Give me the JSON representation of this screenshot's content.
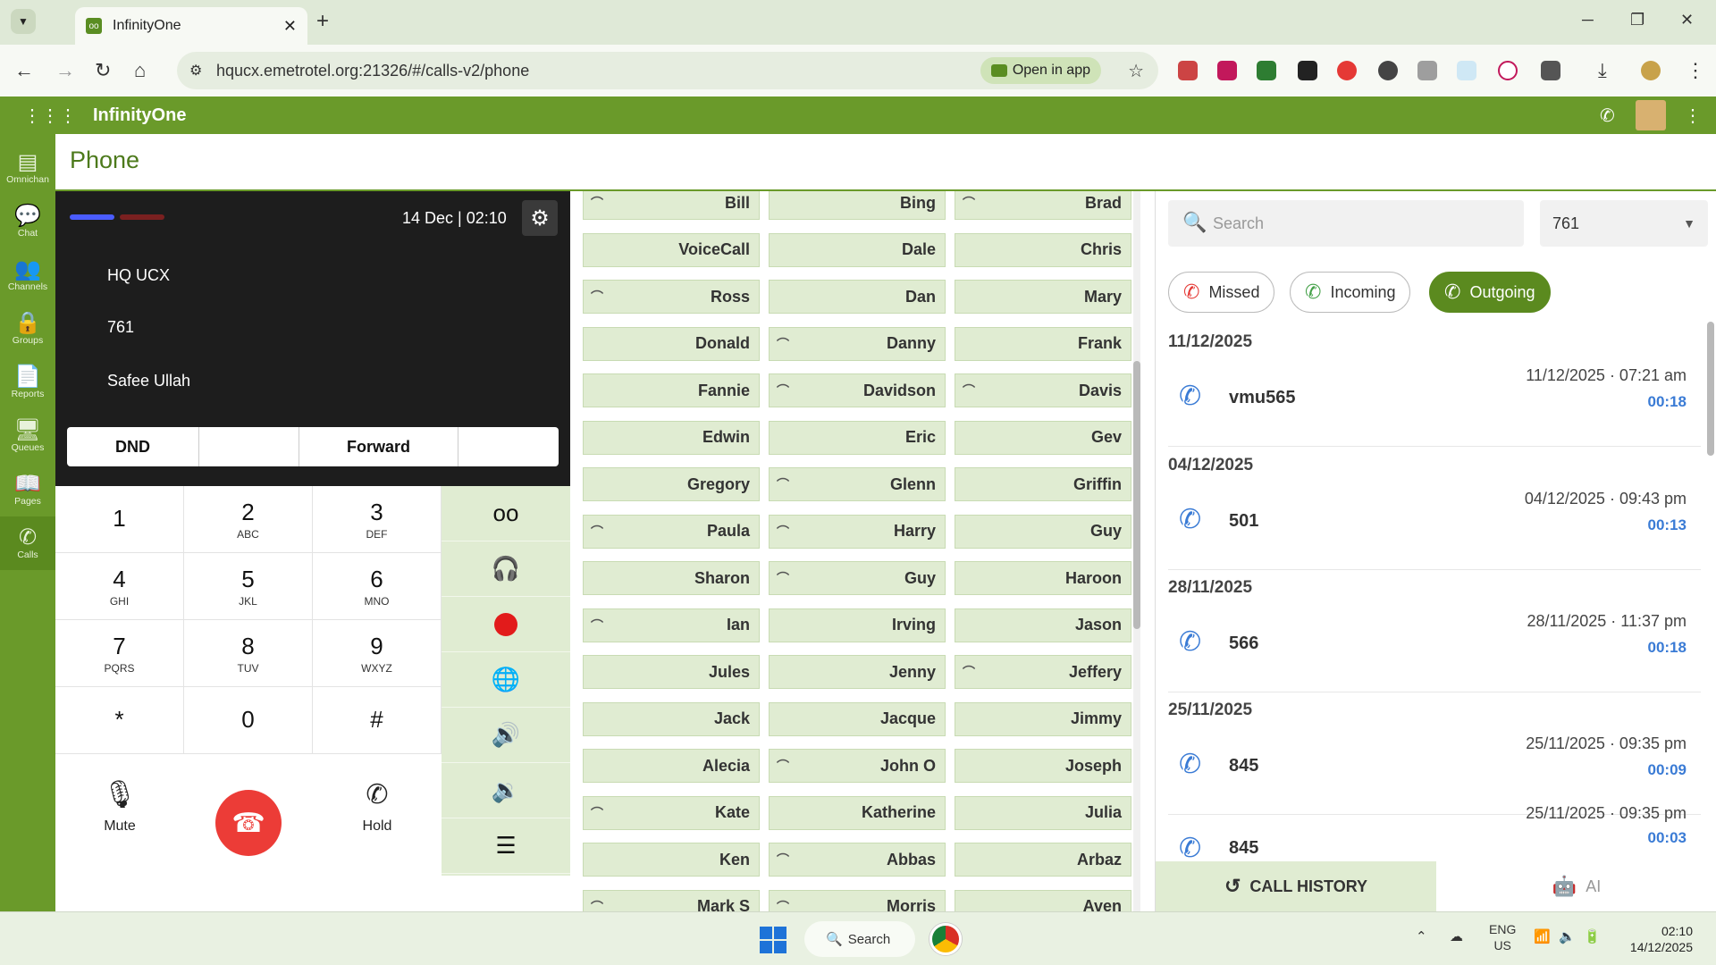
{
  "browser": {
    "tab_title": "InfinityOne",
    "url": "hqucx.emetrotel.org:21326/#/calls-v2/phone",
    "open_in_app": "Open in app"
  },
  "app": {
    "title": "InfinityOne"
  },
  "sidebar": {
    "items": [
      {
        "label": "Omnichan",
        "icon": "omnichannel-icon"
      },
      {
        "label": "Chat",
        "icon": "chat-icon"
      },
      {
        "label": "Channels",
        "icon": "channels-icon"
      },
      {
        "label": "Groups",
        "icon": "groups-icon"
      },
      {
        "label": "Reports",
        "icon": "reports-icon"
      },
      {
        "label": "Queues",
        "icon": "queues-icon"
      },
      {
        "label": "Pages",
        "icon": "pages-icon"
      },
      {
        "label": "Calls",
        "icon": "calls-icon"
      }
    ]
  },
  "page": {
    "title": "Phone"
  },
  "phone": {
    "date": "14 Dec",
    "time": "02:10",
    "server": "HQ UCX",
    "extension": "761",
    "user": "Safee Ullah",
    "controls": [
      "DND",
      "",
      "Forward",
      ""
    ],
    "keys": [
      {
        "d": "1",
        "l": ""
      },
      {
        "d": "2",
        "l": "ABC"
      },
      {
        "d": "3",
        "l": "DEF"
      },
      {
        "d": "4",
        "l": "GHI"
      },
      {
        "d": "5",
        "l": "JKL"
      },
      {
        "d": "6",
        "l": "MNO"
      },
      {
        "d": "7",
        "l": "PQRS"
      },
      {
        "d": "8",
        "l": "TUV"
      },
      {
        "d": "9",
        "l": "WXYZ"
      },
      {
        "d": "*",
        "l": ""
      },
      {
        "d": "0",
        "l": ""
      },
      {
        "d": "#",
        "l": ""
      }
    ],
    "mute_label": "Mute",
    "hold_label": "Hold"
  },
  "blf": [
    [
      "Bill",
      "Bing",
      "Brad"
    ],
    [
      "VoiceCall",
      "Dale",
      "Chris"
    ],
    [
      "Ross",
      "Dan",
      "Mary"
    ],
    [
      "Donald",
      "Danny",
      "Frank"
    ],
    [
      "Fannie",
      "Davidson",
      "Davis"
    ],
    [
      "Edwin",
      "Eric",
      "Gev"
    ],
    [
      "Gregory",
      "Glenn",
      "Griffin"
    ],
    [
      "Paula",
      "Harry",
      "Guy"
    ],
    [
      "Sharon",
      "Guy",
      "Haroon"
    ],
    [
      "Ian",
      "Irving",
      "Jason"
    ],
    [
      "Jules",
      "Jenny",
      "Jeffery"
    ],
    [
      "Jack",
      "Jacque",
      "Jimmy"
    ],
    [
      "Alecia",
      "John O",
      "Joseph"
    ],
    [
      "Kate",
      "Katherine",
      "Julia"
    ],
    [
      "Ken",
      "Abbas",
      "Arbaz"
    ],
    [
      "Mark S",
      "Morris",
      "Aven"
    ]
  ],
  "history": {
    "search_placeholder": "Search",
    "selected_ext": "761",
    "filters": {
      "missed": "Missed",
      "incoming": "Incoming",
      "outgoing": "Outgoing"
    },
    "groups": [
      {
        "date": "11/12/2025",
        "calls": [
          {
            "name": "vmu565",
            "ts": "11/12/2025 · 07:21 am",
            "dur": "00:18"
          }
        ]
      },
      {
        "date": "04/12/2025",
        "calls": [
          {
            "name": "501",
            "ts": "04/12/2025 · 09:43 pm",
            "dur": "00:13"
          }
        ]
      },
      {
        "date": "28/11/2025",
        "calls": [
          {
            "name": "566",
            "ts": "28/11/2025 · 11:37 pm",
            "dur": "00:18"
          }
        ]
      },
      {
        "date": "25/11/2025",
        "calls": [
          {
            "name": "845",
            "ts": "25/11/2025 · 09:35 pm",
            "dur": "00:09"
          },
          {
            "name": "845",
            "ts": "25/11/2025 · 09:35 pm",
            "dur": "00:03"
          }
        ]
      }
    ],
    "tab_history": "CALL HISTORY",
    "tab_ai": "AI"
  },
  "taskbar": {
    "search": "Search",
    "lang": "ENG",
    "region": "US",
    "time": "02:10",
    "date": "14/12/2025"
  },
  "colors": {
    "brand_green": "#6a9a2a",
    "blf_bg": "#e0ecd2",
    "end_call_red": "#ec3c37",
    "outgoing_blue": "#3a7bd5"
  }
}
